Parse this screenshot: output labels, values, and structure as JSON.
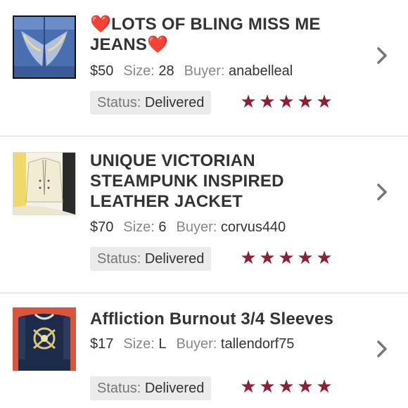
{
  "labels": {
    "size": "Size:",
    "buyer": "Buyer:",
    "status": "Status:"
  },
  "heart_icon": "❤️",
  "star_color": "#8d1f36",
  "items": [
    {
      "title": "LOTS OF BLING MISS ME JEANS",
      "title_decoration": "heart-icon",
      "price": "$50",
      "size": "28",
      "buyer": "anabelleal",
      "status": "Delivered",
      "rating": 5
    },
    {
      "title": "UNIQUE VICTORIAN STEAMPUNK INSPIRED LEATHER JACKET",
      "price": "$70",
      "size": "6",
      "buyer": "corvus440",
      "status": "Delivered",
      "rating": 5
    },
    {
      "title": "Affliction Burnout 3/4 Sleeves",
      "price": "$17",
      "size": "L",
      "buyer": "tallendorf75",
      "status": "Delivered",
      "rating": 5
    }
  ]
}
